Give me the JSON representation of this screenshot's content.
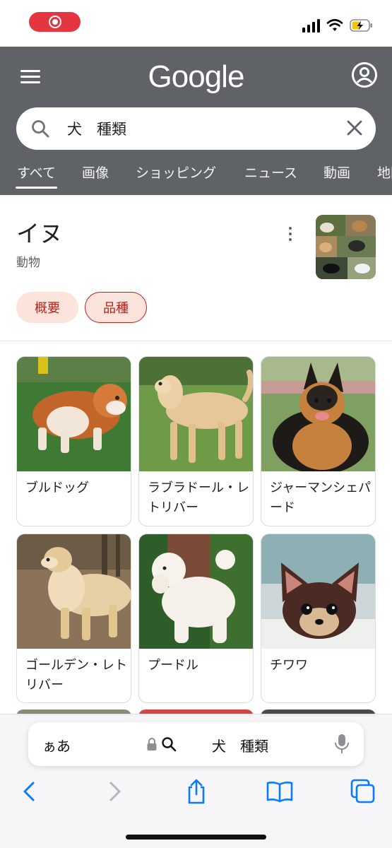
{
  "status_bar": {
    "recording_indicator": "screen-recording",
    "icons": [
      "signal-icon",
      "wifi-icon",
      "battery-charging-icon"
    ]
  },
  "header": {
    "logo_text": "Google",
    "menu_icon": "hamburger-menu-icon",
    "account_icon": "account-circle-icon"
  },
  "search": {
    "query": "犬　種類",
    "icon": "search-icon",
    "clear_icon": "close-icon"
  },
  "tabs": [
    {
      "label": "すべて",
      "active": true
    },
    {
      "label": "画像",
      "active": false
    },
    {
      "label": "ショッピング",
      "active": false
    },
    {
      "label": "ニュース",
      "active": false
    },
    {
      "label": "動画",
      "active": false
    },
    {
      "label": "地図",
      "active": false
    }
  ],
  "knowledge_panel": {
    "title": "イヌ",
    "subtitle": "動物",
    "chips": [
      {
        "label": "概要",
        "selected": false
      },
      {
        "label": "品種",
        "selected": true
      }
    ]
  },
  "breeds": [
    {
      "name": "ブルドッグ"
    },
    {
      "name": "ラブラドール・レトリバー"
    },
    {
      "name": "ジャーマンシェパード"
    },
    {
      "name": "ゴールデン・レトリバー"
    },
    {
      "name": "プードル"
    },
    {
      "name": "チワワ"
    }
  ],
  "safari": {
    "text_size_label": "ぁあ",
    "address_text": "犬　種類",
    "toolbar": [
      "back-icon",
      "forward-icon",
      "share-icon",
      "bookmarks-icon",
      "tabs-icon"
    ]
  },
  "colors": {
    "header_bg": "#5f6368",
    "chip_bg": "#fce3dc",
    "chip_text": "#b3261e",
    "ios_blue": "#0a7aff",
    "record_red": "#e5363f"
  }
}
